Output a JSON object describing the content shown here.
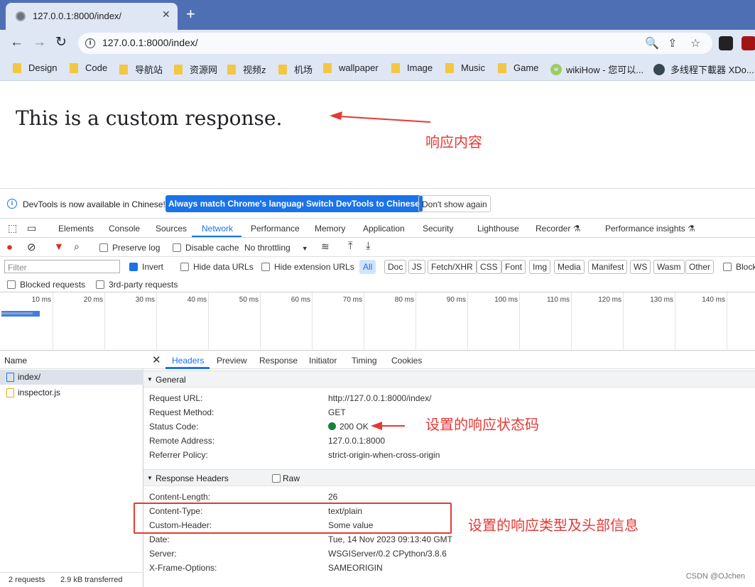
{
  "browser": {
    "tab_title": "127.0.0.1:8000/index/",
    "close_glyph": "✕",
    "new_tab_glyph": "+",
    "address": "127.0.0.1:8000/index/",
    "info_glyph": "i",
    "bookmarks": [
      {
        "label": "Design",
        "icon": "folder-icon"
      },
      {
        "label": "Code",
        "icon": "folder-icon"
      },
      {
        "label": "导航站",
        "icon": "folder-icon"
      },
      {
        "label": "资源网",
        "icon": "folder-icon"
      },
      {
        "label": "视频z",
        "icon": "folder-icon"
      },
      {
        "label": "机场",
        "icon": "folder-icon"
      },
      {
        "label": "wallpaper",
        "icon": "folder-icon"
      },
      {
        "label": "Image",
        "icon": "folder-icon"
      },
      {
        "label": "Music",
        "icon": "folder-icon"
      },
      {
        "label": "Game",
        "icon": "folder-icon"
      },
      {
        "label": "wikiHow - 您可以...",
        "icon": "wikihow-icon"
      },
      {
        "label": "多线程下載器 XDo...",
        "icon": "github-icon"
      }
    ]
  },
  "page": {
    "response_text": "This is a custom response.",
    "annotation_content": "响应内容"
  },
  "devtools": {
    "infobar": {
      "text": "DevTools is now available in Chinese!",
      "btn_match": "Always match Chrome's language",
      "btn_switch": "Switch DevTools to Chinese",
      "btn_dont": "Don't show again"
    },
    "tabs": [
      "Elements",
      "Console",
      "Sources",
      "Network",
      "Performance",
      "Memory",
      "Application",
      "Security",
      "Lighthouse",
      "Recorder ⚗",
      "Performance insights ⚗"
    ],
    "network": {
      "preserve_log": "Preserve log",
      "disable_cache": "Disable cache",
      "throttling": "No throttling",
      "filter_placeholder": "Filter",
      "invert": "Invert",
      "hide_data_urls": "Hide data URLs",
      "hide_ext_urls": "Hide extension URLs",
      "chips": [
        "All",
        "Doc",
        "JS",
        "Fetch/XHR",
        "CSS",
        "Font",
        "Img",
        "Media",
        "Manifest",
        "WS",
        "Wasm",
        "Other"
      ],
      "blocked_cookies": "Block",
      "blocked_requests": "Blocked requests",
      "third_party": "3rd-party requests",
      "ticks": [
        "10 ms",
        "20 ms",
        "30 ms",
        "40 ms",
        "50 ms",
        "60 ms",
        "70 ms",
        "80 ms",
        "90 ms",
        "100 ms",
        "110 ms",
        "120 ms",
        "130 ms",
        "140 ms"
      ]
    },
    "requests": {
      "header": "Name",
      "items": [
        "index/",
        "inspector.js"
      ],
      "status_requests": "2 requests",
      "status_transferred": "2.9 kB transferred"
    },
    "detail": {
      "close_glyph": "✕",
      "tabs": [
        "Headers",
        "Preview",
        "Response",
        "Initiator",
        "Timing",
        "Cookies"
      ],
      "general_title": "General",
      "general": [
        {
          "k": "Request URL:",
          "v": "http://127.0.0.1:8000/index/"
        },
        {
          "k": "Request Method:",
          "v": "GET"
        },
        {
          "k": "Status Code:",
          "v": "200 OK"
        },
        {
          "k": "Remote Address:",
          "v": "127.0.0.1:8000"
        },
        {
          "k": "Referrer Policy:",
          "v": "strict-origin-when-cross-origin"
        }
      ],
      "response_title": "Response Headers",
      "raw_label": "Raw",
      "response": [
        {
          "k": "Content-Length:",
          "v": "26"
        },
        {
          "k": "Content-Type:",
          "v": "text/plain"
        },
        {
          "k": "Custom-Header:",
          "v": "Some value"
        },
        {
          "k": "Date:",
          "v": "Tue, 14 Nov 2023 09:13:40 GMT"
        },
        {
          "k": "Server:",
          "v": "WSGIServer/0.2 CPython/3.8.6"
        },
        {
          "k": "X-Frame-Options:",
          "v": "SAMEORIGIN"
        }
      ]
    }
  },
  "annotations": {
    "status": "设置的响应状态码",
    "headers": "设置的响应类型及头部信息",
    "credit": "CSDN @OJchen"
  },
  "colors": {
    "accent": "#1a73e8",
    "annotation": "#e53935",
    "status_ok": "#188038"
  }
}
